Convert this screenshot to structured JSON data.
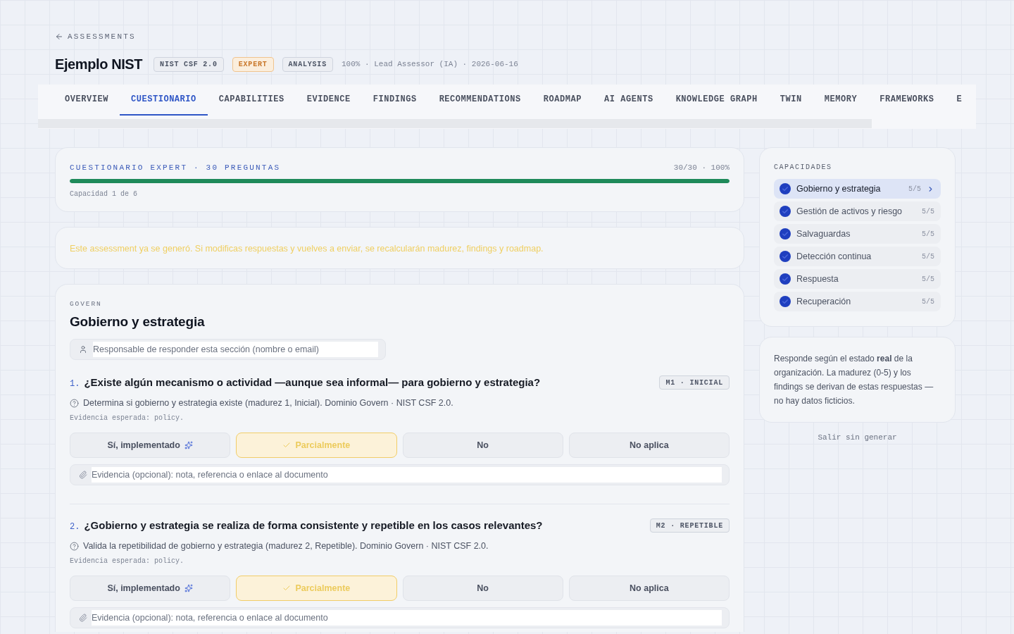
{
  "breadcrumb": {
    "label": "ASSESSMENTS"
  },
  "header": {
    "title": "Ejemplo NIST",
    "badges": [
      {
        "label": "NIST CSF 2.0",
        "kind": "neutral"
      },
      {
        "label": "EXPERT",
        "kind": "warning"
      },
      {
        "label": "ANALYSIS",
        "kind": "neutral"
      }
    ],
    "meta": "100% · Lead Assessor (IA) · 2026-06-16"
  },
  "tabs": [
    {
      "label": "OVERVIEW",
      "selected": false
    },
    {
      "label": "CUESTIONARIO",
      "selected": true
    },
    {
      "label": "CAPABILITIES",
      "selected": false
    },
    {
      "label": "EVIDENCE",
      "selected": false
    },
    {
      "label": "FINDINGS",
      "selected": false
    },
    {
      "label": "RECOMMENDATIONS",
      "selected": false
    },
    {
      "label": "ROADMAP",
      "selected": false
    },
    {
      "label": "AI AGENTS",
      "selected": false
    },
    {
      "label": "KNOWLEDGE GRAPH",
      "selected": false
    },
    {
      "label": "TWIN",
      "selected": false
    },
    {
      "label": "MEMORY",
      "selected": false
    },
    {
      "label": "FRAMEWORKS",
      "selected": false
    },
    {
      "label": "E",
      "selected": false
    }
  ],
  "progress": {
    "title": "CUESTIONARIO EXPERT · 30 PREGUNTAS",
    "reading": "30/30 · 100%",
    "level": 1,
    "caption": "Capacidad 1 de 6"
  },
  "notice": {
    "text": "Este assessment ya se generó. Si modificas respuestas y vuelves a enviar, se recalcularán madurez, findings y roadmap."
  },
  "section": {
    "eyebrow": "GOVERN",
    "title": "Gobierno y estrategia",
    "owner_field": {
      "placeholder": "Responsable de responder esta sección (nombre o email)"
    },
    "questions": [
      {
        "number": "1.",
        "text": "¿Existe algún mecanismo o actividad —aunque sea informal— para gobierno y estrategia?",
        "badge": "M1 · INICIAL",
        "help": "Determina si gobierno y estrategia existe (madurez 1, Inicial). Dominio Govern · NIST CSF 2.0.",
        "expected": "Evidencia esperada: policy.",
        "options": [
          {
            "label": "Sí, implementado",
            "selected": false,
            "ai_suggested": true
          },
          {
            "label": "Parcialmente",
            "selected": true,
            "ai_suggested": false
          },
          {
            "label": "No",
            "selected": false,
            "ai_suggested": false
          },
          {
            "label": "No aplica",
            "selected": false,
            "ai_suggested": false
          }
        ],
        "evidence_field": {
          "placeholder": "Evidencia (opcional): nota, referencia o enlace al documento"
        }
      },
      {
        "number": "2.",
        "text": "¿Gobierno y estrategia se realiza de forma consistente y repetible en los casos relevantes?",
        "badge": "M2 · REPETIBLE",
        "help": "Valida la repetibilidad de gobierno y estrategia (madurez 2, Repetible). Dominio Govern · NIST CSF 2.0.",
        "expected": "Evidencia esperada: policy.",
        "options": [
          {
            "label": "Sí, implementado",
            "selected": false,
            "ai_suggested": true
          },
          {
            "label": "Parcialmente",
            "selected": true,
            "ai_suggested": false
          },
          {
            "label": "No",
            "selected": false,
            "ai_suggested": false
          },
          {
            "label": "No aplica",
            "selected": false,
            "ai_suggested": false
          }
        ],
        "evidence_field": {
          "placeholder": "Evidencia (opcional): nota, referencia o enlace al documento"
        }
      }
    ]
  },
  "sidebar": {
    "title": "CAPACIDADES",
    "items": [
      {
        "label": "Gobierno y estrategia",
        "count": "5/5",
        "selected": true,
        "complete": true
      },
      {
        "label": "Gestión de activos y riesgo",
        "count": "5/5",
        "selected": false,
        "complete": true
      },
      {
        "label": "Salvaguardas",
        "count": "5/5",
        "selected": false,
        "complete": true
      },
      {
        "label": "Detección continua",
        "count": "5/5",
        "selected": false,
        "complete": true
      },
      {
        "label": "Respuesta",
        "count": "5/5",
        "selected": false,
        "complete": true
      },
      {
        "label": "Recuperación",
        "count": "5/5",
        "selected": false,
        "complete": true
      }
    ]
  },
  "info": {
    "text": "Responde según el estado **real** de la organización. La madurez (0-5) y los findings se derivan de estas respuestas — no hay datos ficticios."
  },
  "exit_link": {
    "label": "Salir sin generar"
  }
}
